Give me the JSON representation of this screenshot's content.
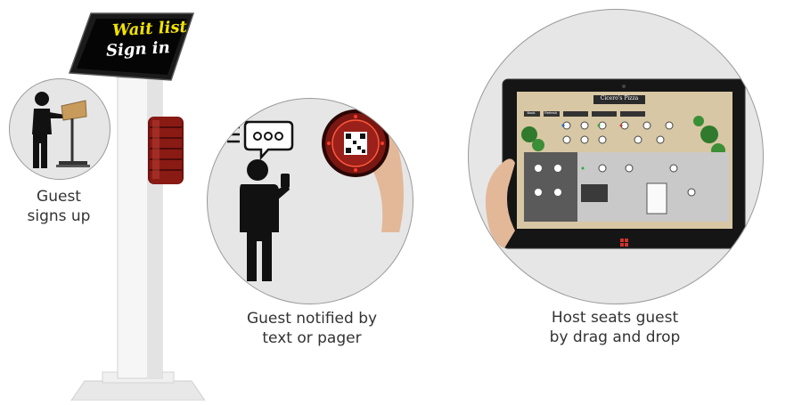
{
  "kiosk": {
    "screen_line1": "Wait list",
    "screen_line2": "Sign in",
    "colors": {
      "line1": "#f2e300",
      "line2": "#ffffff",
      "stand": "#f2f2f2",
      "pager": "#8a1a14"
    }
  },
  "steps": [
    {
      "caption_line1": "Guest",
      "caption_line2": "signs up",
      "icon": "person-at-podium-icon"
    },
    {
      "caption_line1": "Guest notified by",
      "caption_line2": "text or pager",
      "icon": "person-with-phone-icon"
    },
    {
      "caption_line1": "Host seats guest",
      "caption_line2": "by drag and drop",
      "icon": "tablet-floor-plan-icon"
    }
  ],
  "tablet": {
    "app_title": "Cicero's Pizza",
    "toolbar": [
      "Back",
      "Refresh",
      "",
      "",
      ""
    ]
  }
}
